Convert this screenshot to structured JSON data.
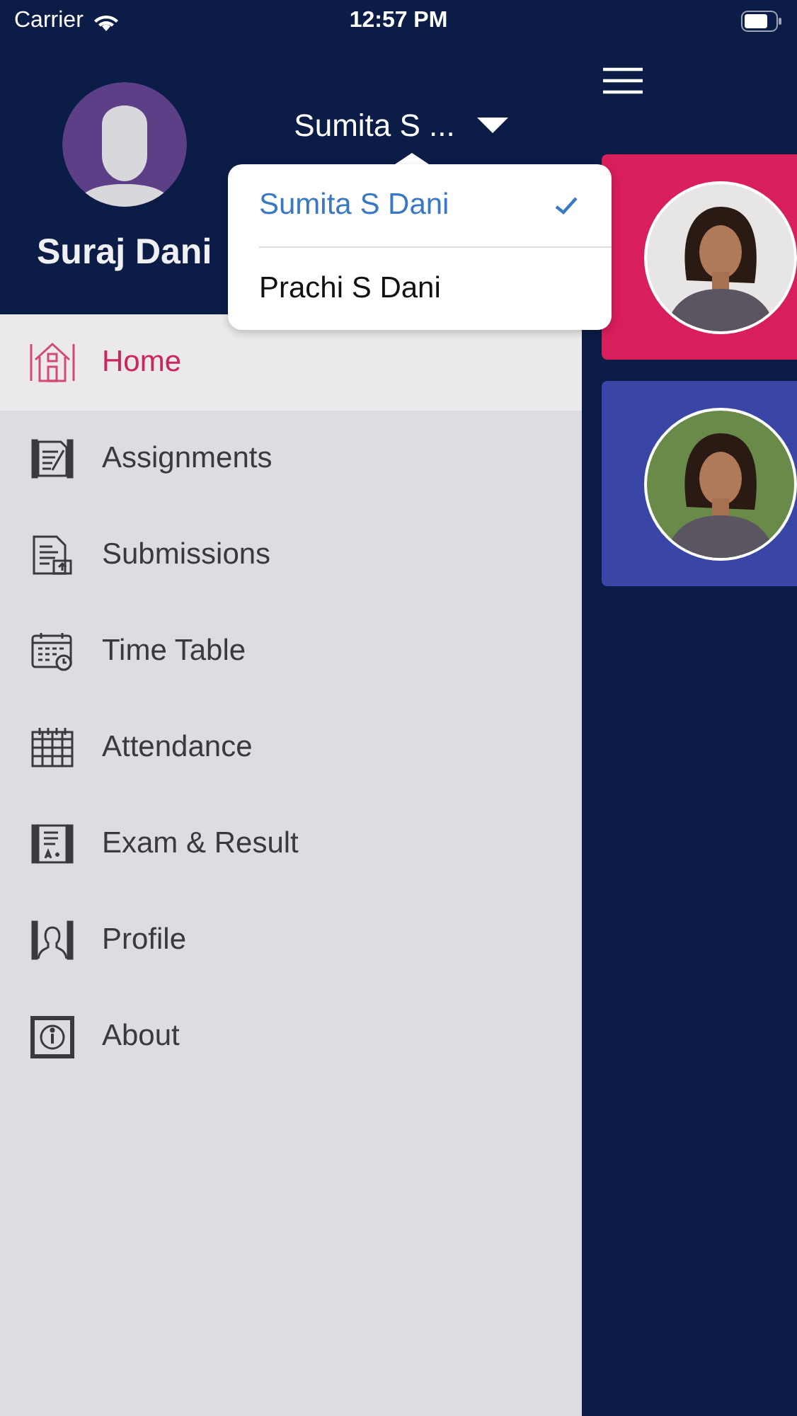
{
  "status_bar": {
    "carrier": "Carrier",
    "time": "12:57 PM"
  },
  "drawer": {
    "user_name": "Suraj Dani",
    "student_picker": {
      "value": "Sumita S ...",
      "options": [
        {
          "label": "Sumita S Dani",
          "selected": true
        },
        {
          "label": "Prachi S Dani",
          "selected": false
        }
      ]
    },
    "menu": [
      {
        "label": "Home",
        "selected": true
      },
      {
        "label": "Assignments",
        "selected": false
      },
      {
        "label": "Submissions",
        "selected": false
      },
      {
        "label": "Time Table",
        "selected": false
      },
      {
        "label": "Attendance",
        "selected": false
      },
      {
        "label": "Exam & Result",
        "selected": false
      },
      {
        "label": "Profile",
        "selected": false
      },
      {
        "label": "About",
        "selected": false
      }
    ]
  }
}
